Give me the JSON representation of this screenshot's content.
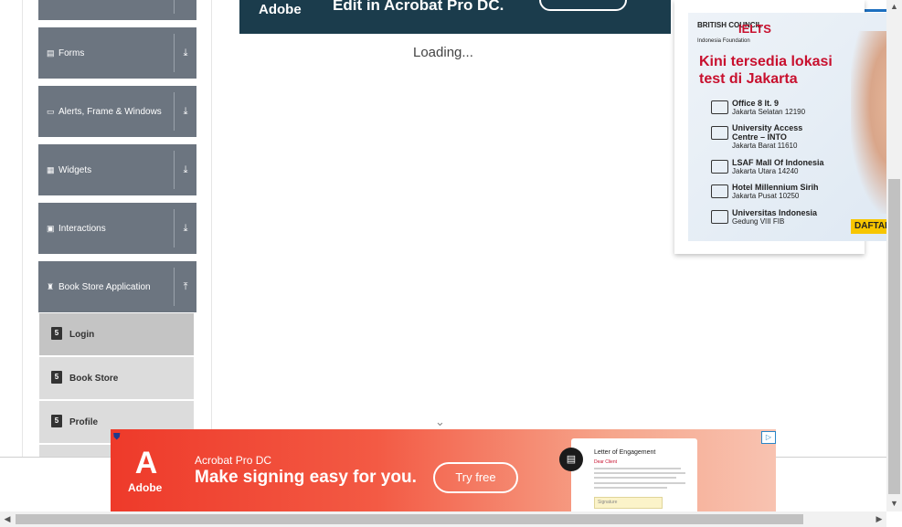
{
  "sidebar": {
    "groups": [
      {
        "label": "",
        "icon": "blank-icon"
      },
      {
        "label": "Forms",
        "icon": "form-icon"
      },
      {
        "label": "Alerts, Frame & Windows",
        "icon": "window-icon"
      },
      {
        "label": "Widgets",
        "icon": "grid-icon"
      },
      {
        "label": "Interactions",
        "icon": "interactions-icon"
      },
      {
        "label": "Book Store Application",
        "icon": "bookstore-icon"
      }
    ],
    "subitems": [
      {
        "label": "Login"
      },
      {
        "label": "Book Store"
      },
      {
        "label": "Profile"
      }
    ]
  },
  "main": {
    "loading_text": "Loading...",
    "top_ad": {
      "logo": "Adobe",
      "headline": "Edit in Acrobat Pro DC."
    }
  },
  "right_ad": {
    "brand": "BRITISH COUNCIL",
    "product": "IELTS",
    "foundation": "Indonesia Foundation",
    "headline_line1": "Kini tersedia lokasi",
    "headline_line2": "test di Jakarta",
    "locations": [
      {
        "name": "Office 8 lt. 9",
        "detail": "Jakarta Selatan 12190"
      },
      {
        "name": "University Access",
        "name2": "Centre – INTO",
        "detail": "Jakarta Barat 11610"
      },
      {
        "name": "LSAF Mall Of Indonesia",
        "detail": "Jakarta Utara 14240"
      },
      {
        "name": "Hotel Millennium Sirih",
        "detail": "Jakarta Pusat 10250"
      },
      {
        "name": "Universitas Indonesia",
        "detail": "Gedung VIII FIB"
      }
    ],
    "cta": "DAFTAR"
  },
  "bottom_ad": {
    "logo": "Adobe",
    "subtitle": "Acrobat Pro DC",
    "headline": "Make signing easy for you.",
    "button": "Try free",
    "doc_title": "Letter of Engagement",
    "doc_name": "Dear Client",
    "signature_placeholder": "Signature",
    "colors": {
      "primary": "#ee3a2a",
      "dark": "#1b3c4c"
    }
  }
}
